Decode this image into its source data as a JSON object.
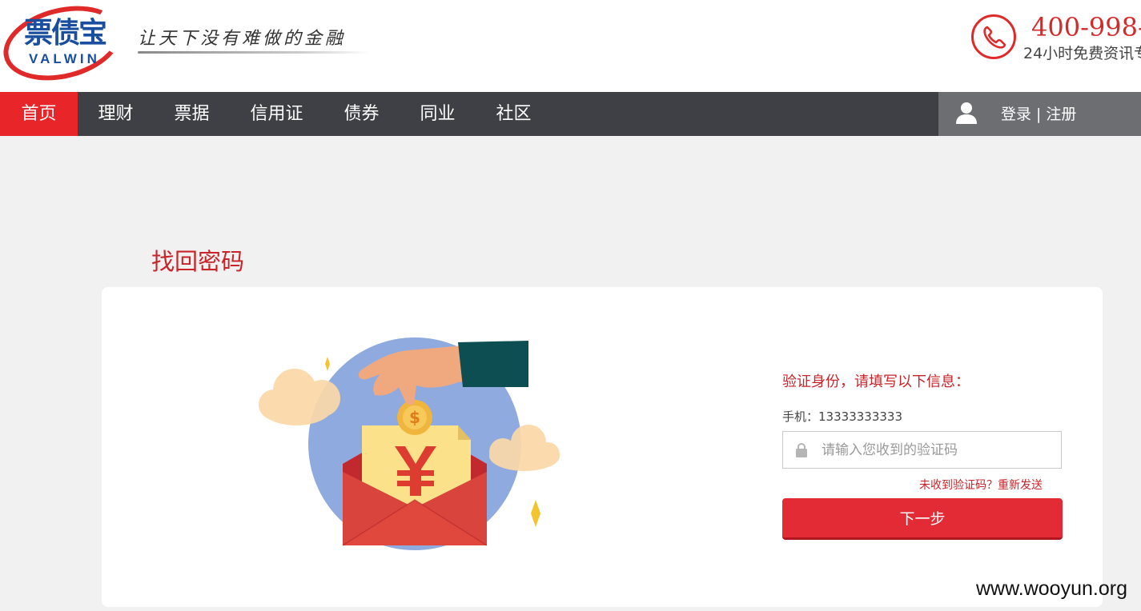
{
  "header": {
    "logo": {
      "cn": "票债宝",
      "en": "VALWIN"
    },
    "slogan": "让天下没有难做的金融",
    "hotline": "400-998-",
    "hotline_sub": "24小时免费资讯专"
  },
  "nav": {
    "items": [
      {
        "label": "首页",
        "active": true
      },
      {
        "label": "理财"
      },
      {
        "label": "票据"
      },
      {
        "label": "信用证"
      },
      {
        "label": "债券"
      },
      {
        "label": "同业"
      },
      {
        "label": "社区"
      }
    ],
    "login": "登录",
    "separator": "|",
    "register": "注册"
  },
  "page": {
    "title": "找回密码"
  },
  "form": {
    "heading": "验证身份，请填写以下信息：",
    "phone_label": "手机：",
    "phone_value": "13333333333",
    "code_placeholder": "请输入您收到的验证码",
    "code_value": "",
    "resend": "未收到验证码？重新发送",
    "next_button": "下一步"
  },
  "watermark": "www.wooyun.org",
  "colors": {
    "brand_red": "#e8262a",
    "nav_bg": "#3f4045",
    "user_box_bg": "#6d6e72",
    "title_red": "#c8242a",
    "button_red": "#e32b36",
    "page_bg": "#f0f1f0"
  },
  "icons": [
    "phone-icon",
    "user-icon",
    "lock-icon"
  ]
}
